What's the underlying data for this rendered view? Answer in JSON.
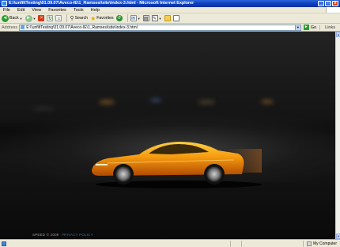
{
  "window": {
    "title": "E:\\\\unfiltTesting\\01.09.07\\Aveco-IE\\1_Ramsesi\\site\\index-3.html - Microsoft Internet Explorer",
    "minimize": "_",
    "maximize": "□",
    "close": "x"
  },
  "menu": [
    "File",
    "Edit",
    "View",
    "Favorites",
    "Tools",
    "Help"
  ],
  "toolbar": {
    "back_label": "Back",
    "search_label": "Search",
    "favorites_label": "Favorites"
  },
  "address": {
    "label": "Address",
    "url": "E:\\\\unfiltTesting\\01.09.07\\Aveco-IE\\1_Ramsesi\\site\\index-3.html",
    "go_label": "Go",
    "links_label": "Links"
  },
  "page": {
    "footer_copyright": "SPEED © 2009",
    "footer_policy": "PRIVACY POLICY"
  },
  "status": {
    "zone_label": "My Computer"
  },
  "colors": {
    "car_body": "#f59a10",
    "background": "#151515",
    "accent_title": "#0a3fc0"
  }
}
